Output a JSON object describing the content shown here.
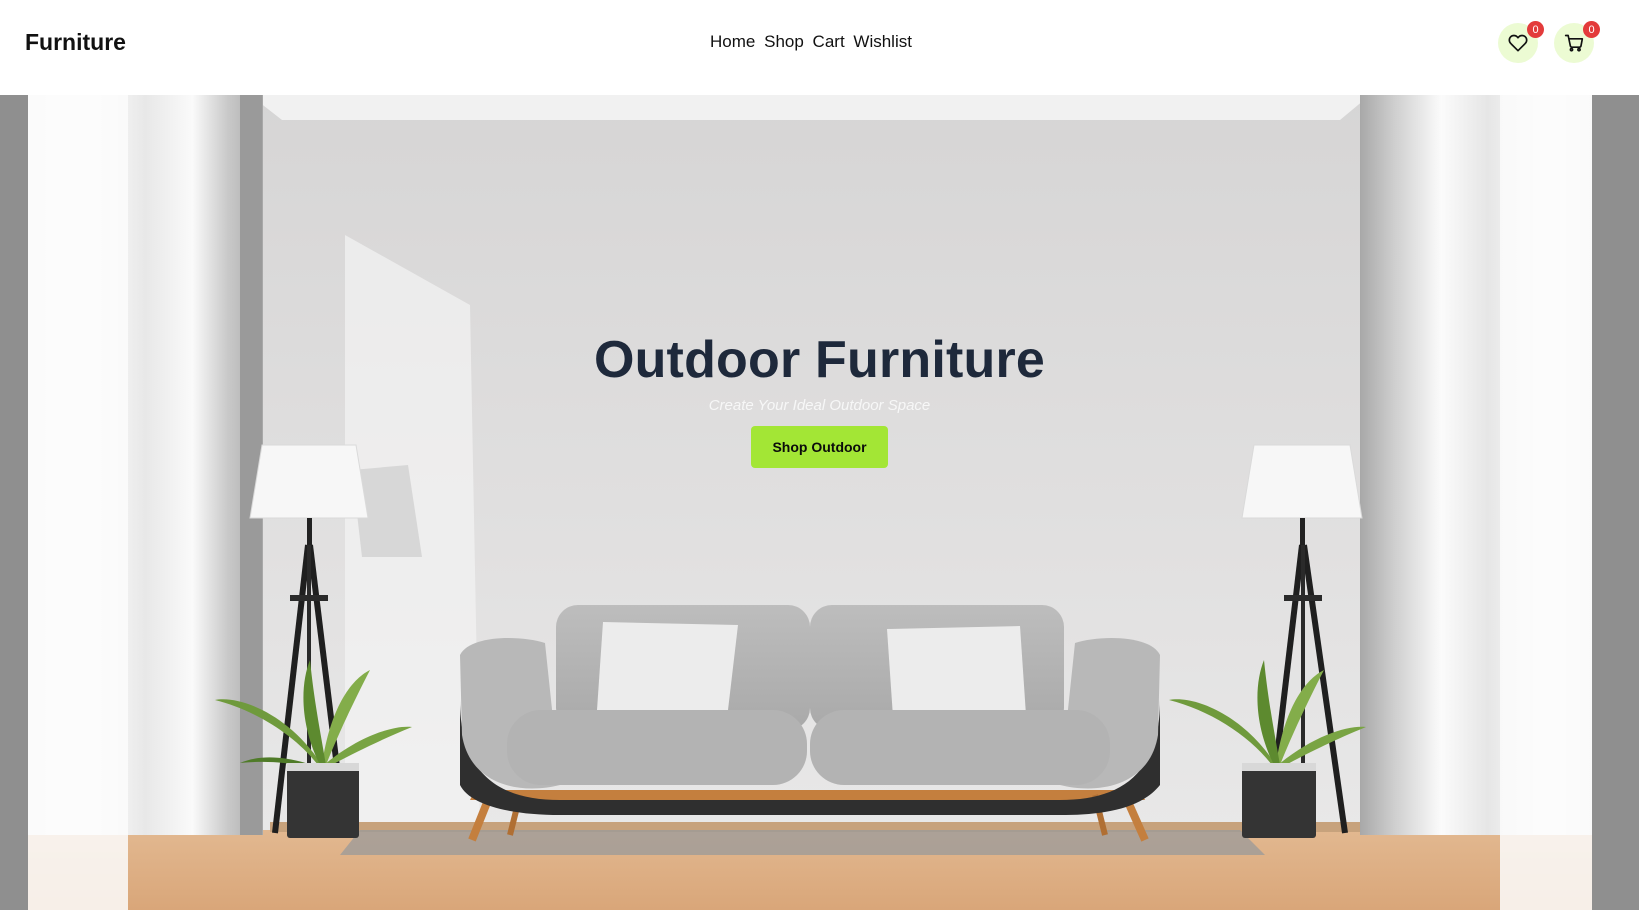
{
  "brand": {
    "logo": "Furniture"
  },
  "nav": {
    "items": [
      "Home",
      "Shop",
      "Cart",
      "Wishlist"
    ]
  },
  "header_actions": {
    "wishlist": {
      "icon": "heart-icon",
      "count": "0"
    },
    "cart": {
      "icon": "cart-icon",
      "count": "0"
    }
  },
  "hero": {
    "title": "Outdoor Furniture",
    "subtitle": "Create Your Ideal Outdoor Space",
    "cta": "Shop Outdoor"
  },
  "colors": {
    "accent": "#a3e635",
    "badge": "#e33b3b",
    "icon_bg": "#ecfbd3",
    "title": "#1e293b"
  }
}
